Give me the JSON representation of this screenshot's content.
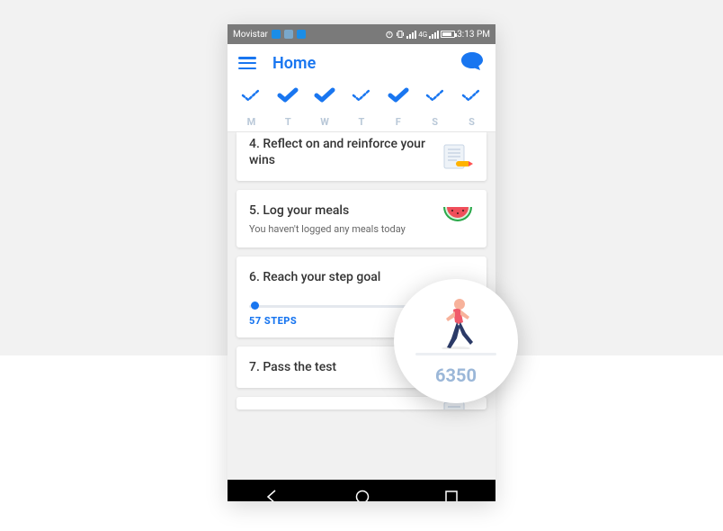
{
  "statusbar": {
    "carrier": "Movistar",
    "network": "4G",
    "time": "3:13 PM"
  },
  "header": {
    "title": "Home"
  },
  "days": [
    {
      "label": "M",
      "solid": false
    },
    {
      "label": "T",
      "solid": true
    },
    {
      "label": "W",
      "solid": true
    },
    {
      "label": "T",
      "solid": false
    },
    {
      "label": "F",
      "solid": true
    },
    {
      "label": "S",
      "solid": false
    },
    {
      "label": "S",
      "solid": false
    }
  ],
  "cards": {
    "c4": {
      "title": "4. Reflect on and reinforce your wins"
    },
    "c5": {
      "title": "5. Log your meals",
      "sub": "You haven't logged any meals today"
    },
    "c6": {
      "title": "6. Reach your step goal",
      "steps": "57 STEPS"
    },
    "c7": {
      "title": "7. Pass the test"
    }
  },
  "bubble": {
    "count": "6350"
  }
}
